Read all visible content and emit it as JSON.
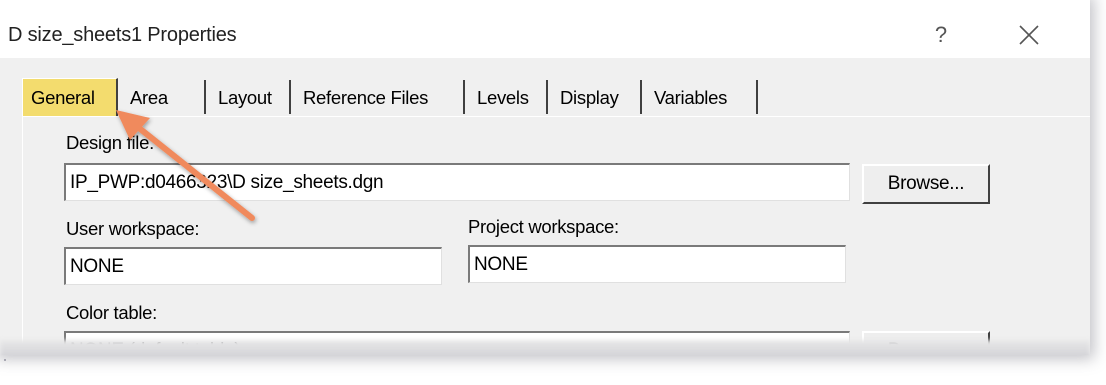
{
  "window": {
    "title": "D size_sheets1 Properties",
    "help_label": "?",
    "close_icon": "close-icon"
  },
  "tabs": [
    {
      "label": "General",
      "active": true
    },
    {
      "label": "Area",
      "active": false
    },
    {
      "label": "Layout",
      "active": false
    },
    {
      "label": "Reference Files",
      "active": false
    },
    {
      "label": "Levels",
      "active": false
    },
    {
      "label": "Display",
      "active": false
    },
    {
      "label": "Variables",
      "active": false
    }
  ],
  "general": {
    "design_file_label": "Design file:",
    "design_file_value": "IP_PWP:d0466323\\D size_sheets.dgn",
    "browse_label": "Browse...",
    "user_workspace_label": "User workspace:",
    "user_workspace_value": "NONE",
    "project_workspace_label": "Project workspace:",
    "project_workspace_value": "NONE",
    "color_table_label": "Color table:",
    "color_table_value": "NONE (default table)",
    "color_browse_label": "Browse..."
  },
  "annotation": {
    "arrow_color": "#f08a5d",
    "active_tab_highlight": "#f3dc6e"
  }
}
